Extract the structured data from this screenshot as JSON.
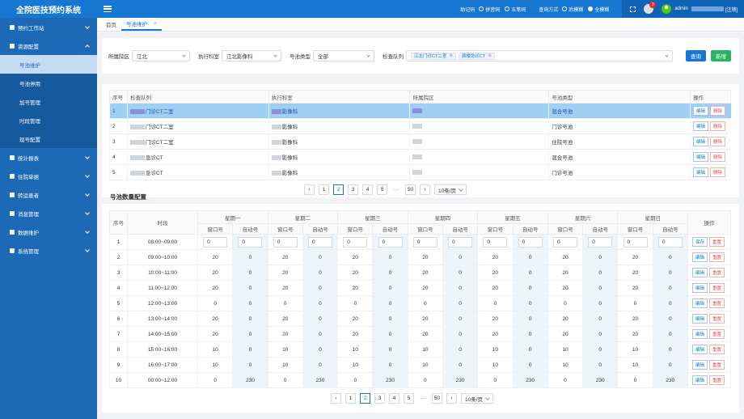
{
  "app": {
    "title": "全院医技预约系统"
  },
  "header": {
    "memo_label": "助记码",
    "memo_options": [
      {
        "label": "拼音码",
        "on": false
      },
      {
        "label": "五笔码",
        "on": false
      }
    ],
    "query_label": "查询方式",
    "query_options": [
      {
        "label": "后模糊",
        "on": false
      },
      {
        "label": "全模糊",
        "on": true
      }
    ],
    "notify_count": "3",
    "user": "admin",
    "logout": "[注销]"
  },
  "sidebar": {
    "items": [
      {
        "label": "预约工作站"
      },
      {
        "label": "资源配置",
        "open": true,
        "children": [
          "号池维护",
          "号池停用",
          "加号管理",
          "时段管理",
          "现号配置"
        ]
      },
      {
        "label": "统计报表"
      },
      {
        "label": "住院单据"
      },
      {
        "label": "转运患者"
      },
      {
        "label": "消息管理"
      },
      {
        "label": "数据维护"
      },
      {
        "label": "系统管理"
      }
    ]
  },
  "tabs": [
    {
      "label": "首页"
    },
    {
      "label": "号池维护",
      "active": true
    }
  ],
  "filters": {
    "district_label": "所属院区",
    "district_value": "江北",
    "dept_label": "执行科室",
    "dept_value": "江北影像科",
    "pool_type_label": "号池类型",
    "pool_type_value": "全部",
    "queue_label": "检查队列",
    "queue_tags": [
      "江北门诊CT二室",
      "颜楼急诊CT"
    ],
    "search_label": "查询",
    "add_label": "新增"
  },
  "list_table": {
    "headers": [
      "序号",
      "检查队列",
      "执行科室",
      "所属院区",
      "号池类型",
      "操作"
    ],
    "rows": [
      {
        "no": "1",
        "queue": "门诊CT二室",
        "dept": "影像科",
        "type": "混合号池",
        "selected": true
      },
      {
        "no": "2",
        "queue": "门诊CT二室",
        "dept": "影像科",
        "type": "门诊号池"
      },
      {
        "no": "3",
        "queue": "门诊CT二室",
        "dept": "影像科",
        "type": "住院号池"
      },
      {
        "no": "4",
        "queue": "急诊CT",
        "dept": "影像科",
        "type": "混合号池"
      },
      {
        "no": "5",
        "queue": "急诊CT",
        "dept": "影像科",
        "type": "门诊号池"
      }
    ],
    "edit_label": "编辑",
    "delete_label": "删除"
  },
  "pager1": {
    "pages": [
      "1",
      "2",
      "3",
      "4",
      "5",
      "···",
      "50"
    ],
    "current": "2",
    "size": "10条/页"
  },
  "config": {
    "title": "号池数量配置",
    "col_no": "序号",
    "col_period": "时段",
    "col_op": "操作",
    "days": [
      "星期一",
      "星期二",
      "星期三",
      "星期四",
      "星期五",
      "星期六",
      "星期日"
    ],
    "sub_window": "窗口号",
    "sub_auto": "自动号",
    "save_label": "保存",
    "reset_label": "重置",
    "edit_label": "编辑",
    "rows": [
      {
        "no": "1",
        "period": "08:00~09:00",
        "window": "0",
        "auto": "0",
        "editing": true
      },
      {
        "no": "2",
        "period": "09:00~10:00",
        "window": "20",
        "auto": "0"
      },
      {
        "no": "3",
        "period": "10:00~11:00",
        "window": "20",
        "auto": "0"
      },
      {
        "no": "4",
        "period": "11:00~12:00",
        "window": "20",
        "auto": "0"
      },
      {
        "no": "5",
        "period": "12:00~13:00",
        "window": "0",
        "auto": "0"
      },
      {
        "no": "6",
        "period": "13:00~14:00",
        "window": "20",
        "auto": "0"
      },
      {
        "no": "7",
        "period": "14:00~15:00",
        "window": "20",
        "auto": "0"
      },
      {
        "no": "8",
        "period": "15:00~16:00",
        "window": "10",
        "auto": "0"
      },
      {
        "no": "9",
        "period": "16:00~17:00",
        "window": "10",
        "auto": "0"
      },
      {
        "no": "10",
        "period": "00:00~12:00",
        "window": "0",
        "auto": "230"
      }
    ]
  },
  "pager2": {
    "pages": [
      "1",
      "2",
      "3",
      "4",
      "5",
      "···",
      "50"
    ],
    "current": "2",
    "size": "10条/页"
  }
}
